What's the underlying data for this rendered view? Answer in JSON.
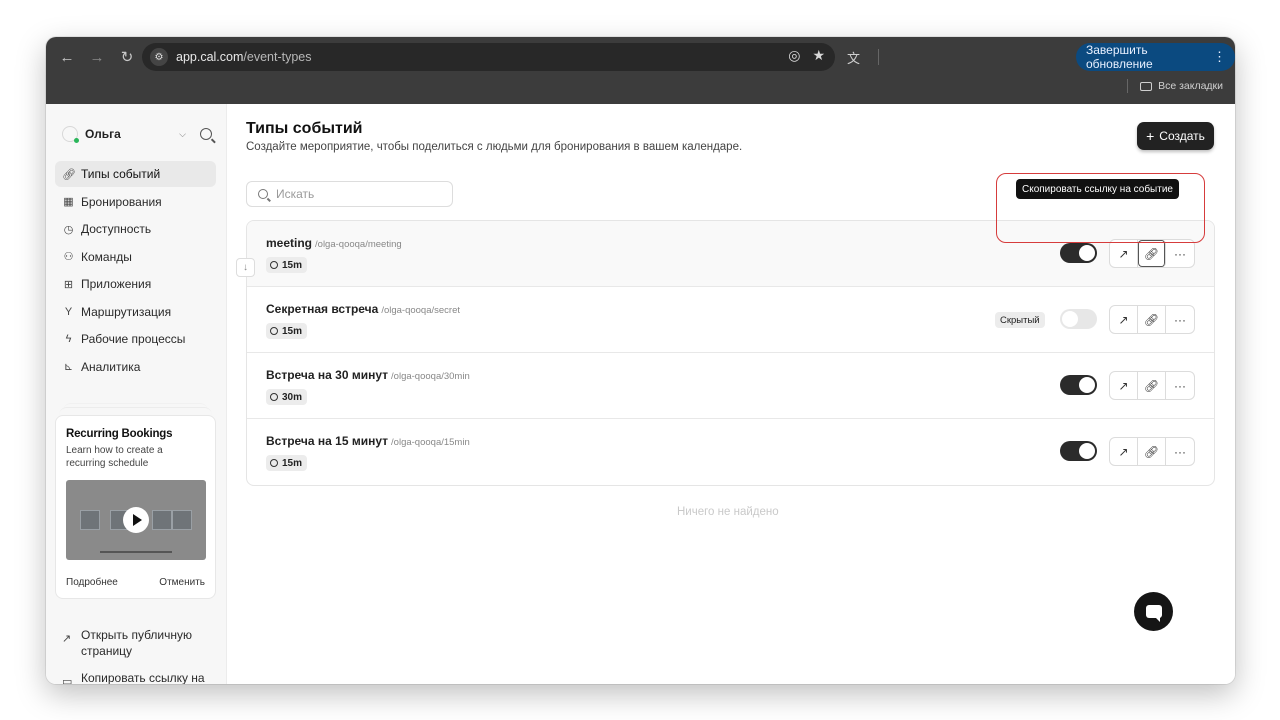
{
  "browser": {
    "url_host": "app.cal.com",
    "url_path": "/event-types",
    "update_label": "Завершить обновление",
    "bookmarks_label": "Все закладки"
  },
  "sidebar": {
    "user_name": "Ольга",
    "items": [
      {
        "label": "Типы событий",
        "icon": "link-icon",
        "active": true
      },
      {
        "label": "Бронирования",
        "icon": "calendar-icon"
      },
      {
        "label": "Доступность",
        "icon": "clock-icon"
      },
      {
        "label": "Команды",
        "icon": "users-icon"
      },
      {
        "label": "Приложения",
        "icon": "grid-icon"
      },
      {
        "label": "Маршрутизация",
        "icon": "routing-icon"
      },
      {
        "label": "Рабочие процессы",
        "icon": "zap-icon"
      },
      {
        "label": "Аналитика",
        "icon": "chart-icon"
      }
    ],
    "promo": {
      "title": "Recurring Bookings",
      "text": "Learn how to create a recurring schedule",
      "more": "Подробнее",
      "dismiss": "Отменить"
    },
    "links": {
      "public_page": "Открыть публичную страницу",
      "copy_link": "Копировать ссылку на"
    }
  },
  "main": {
    "title": "Типы событий",
    "subtitle": "Создайте мероприятие, чтобы поделиться с людьми для бронирования в вашем календаре.",
    "create_label": "Создать",
    "search_placeholder": "Искать",
    "empty_text": "Ничего не найдено",
    "tooltip": "Скопировать ссылку на событие",
    "events": [
      {
        "title": "meeting",
        "slug": "/olga-qooqa/meeting",
        "duration": "15m",
        "enabled": true
      },
      {
        "title": "Секретная встреча",
        "slug": "/olga-qooqa/secret",
        "duration": "15m",
        "enabled": false,
        "badge": "Скрытый"
      },
      {
        "title": "Встреча на 30 минут",
        "slug": "/olga-qooqa/30min",
        "duration": "30m",
        "enabled": true
      },
      {
        "title": "Встреча на 15 минут",
        "slug": "/olga-qooqa/15min",
        "duration": "15m",
        "enabled": true
      }
    ]
  },
  "colors": {
    "chrome_bg": "#3c3c3c",
    "update_button": "#0b4a80",
    "toggle_on": "#2b2b2b",
    "highlight": "#d63c3c"
  }
}
